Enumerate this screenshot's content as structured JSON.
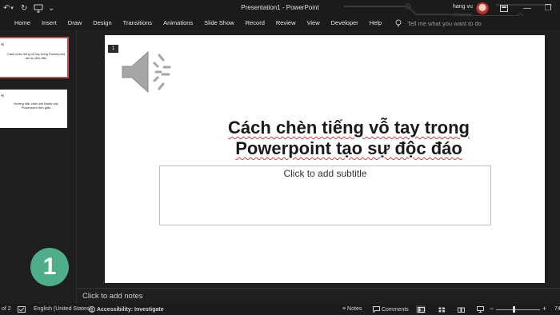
{
  "window": {
    "title": "Presentation1 - PowerPoint",
    "user_name": "hang vu",
    "minimize": "—",
    "restore": "❐",
    "close": "✕"
  },
  "quick_access": {
    "undo": "↶",
    "undo_dropdown": "▾",
    "redo": "↻",
    "customize": "⌄"
  },
  "ribbon": {
    "tabs": [
      "Home",
      "Insert",
      "Draw",
      "Design",
      "Transitions",
      "Animations",
      "Slide Show",
      "Record",
      "Review",
      "View",
      "Developer",
      "Help"
    ],
    "tell_me_placeholder": "Tell me what you want to do"
  },
  "thumbnails": [
    {
      "text": "Cách chèn tiếng vỗ tay trong Powerpoint tạo sự độc đáo",
      "selected": true
    },
    {
      "text": "Hướng dẫn chèn âm thanh vào Powerpoint đơn giản",
      "selected": false
    }
  ],
  "badge": "1",
  "slide": {
    "number_tag": "1",
    "title_line1": "Cách chèn tiếng vỗ tay trong",
    "title_line2": "Powerpoint tạo sự độc đáo",
    "subtitle_placeholder": "Click to add subtitle"
  },
  "notes_placeholder": "Click to add notes",
  "status_bar": {
    "slide_count": "of 2",
    "language": "English (United States)",
    "accessibility": "Accessibility: Investigate",
    "notes_label": "Notes",
    "comments_label": "Comments",
    "zoom_minus": "−",
    "zoom_plus": "+",
    "zoom_value": "74"
  },
  "colors": {
    "accent_selected_thumb": "#c0504d",
    "badge": "#4fae8a",
    "background": "#1f1f1f"
  }
}
